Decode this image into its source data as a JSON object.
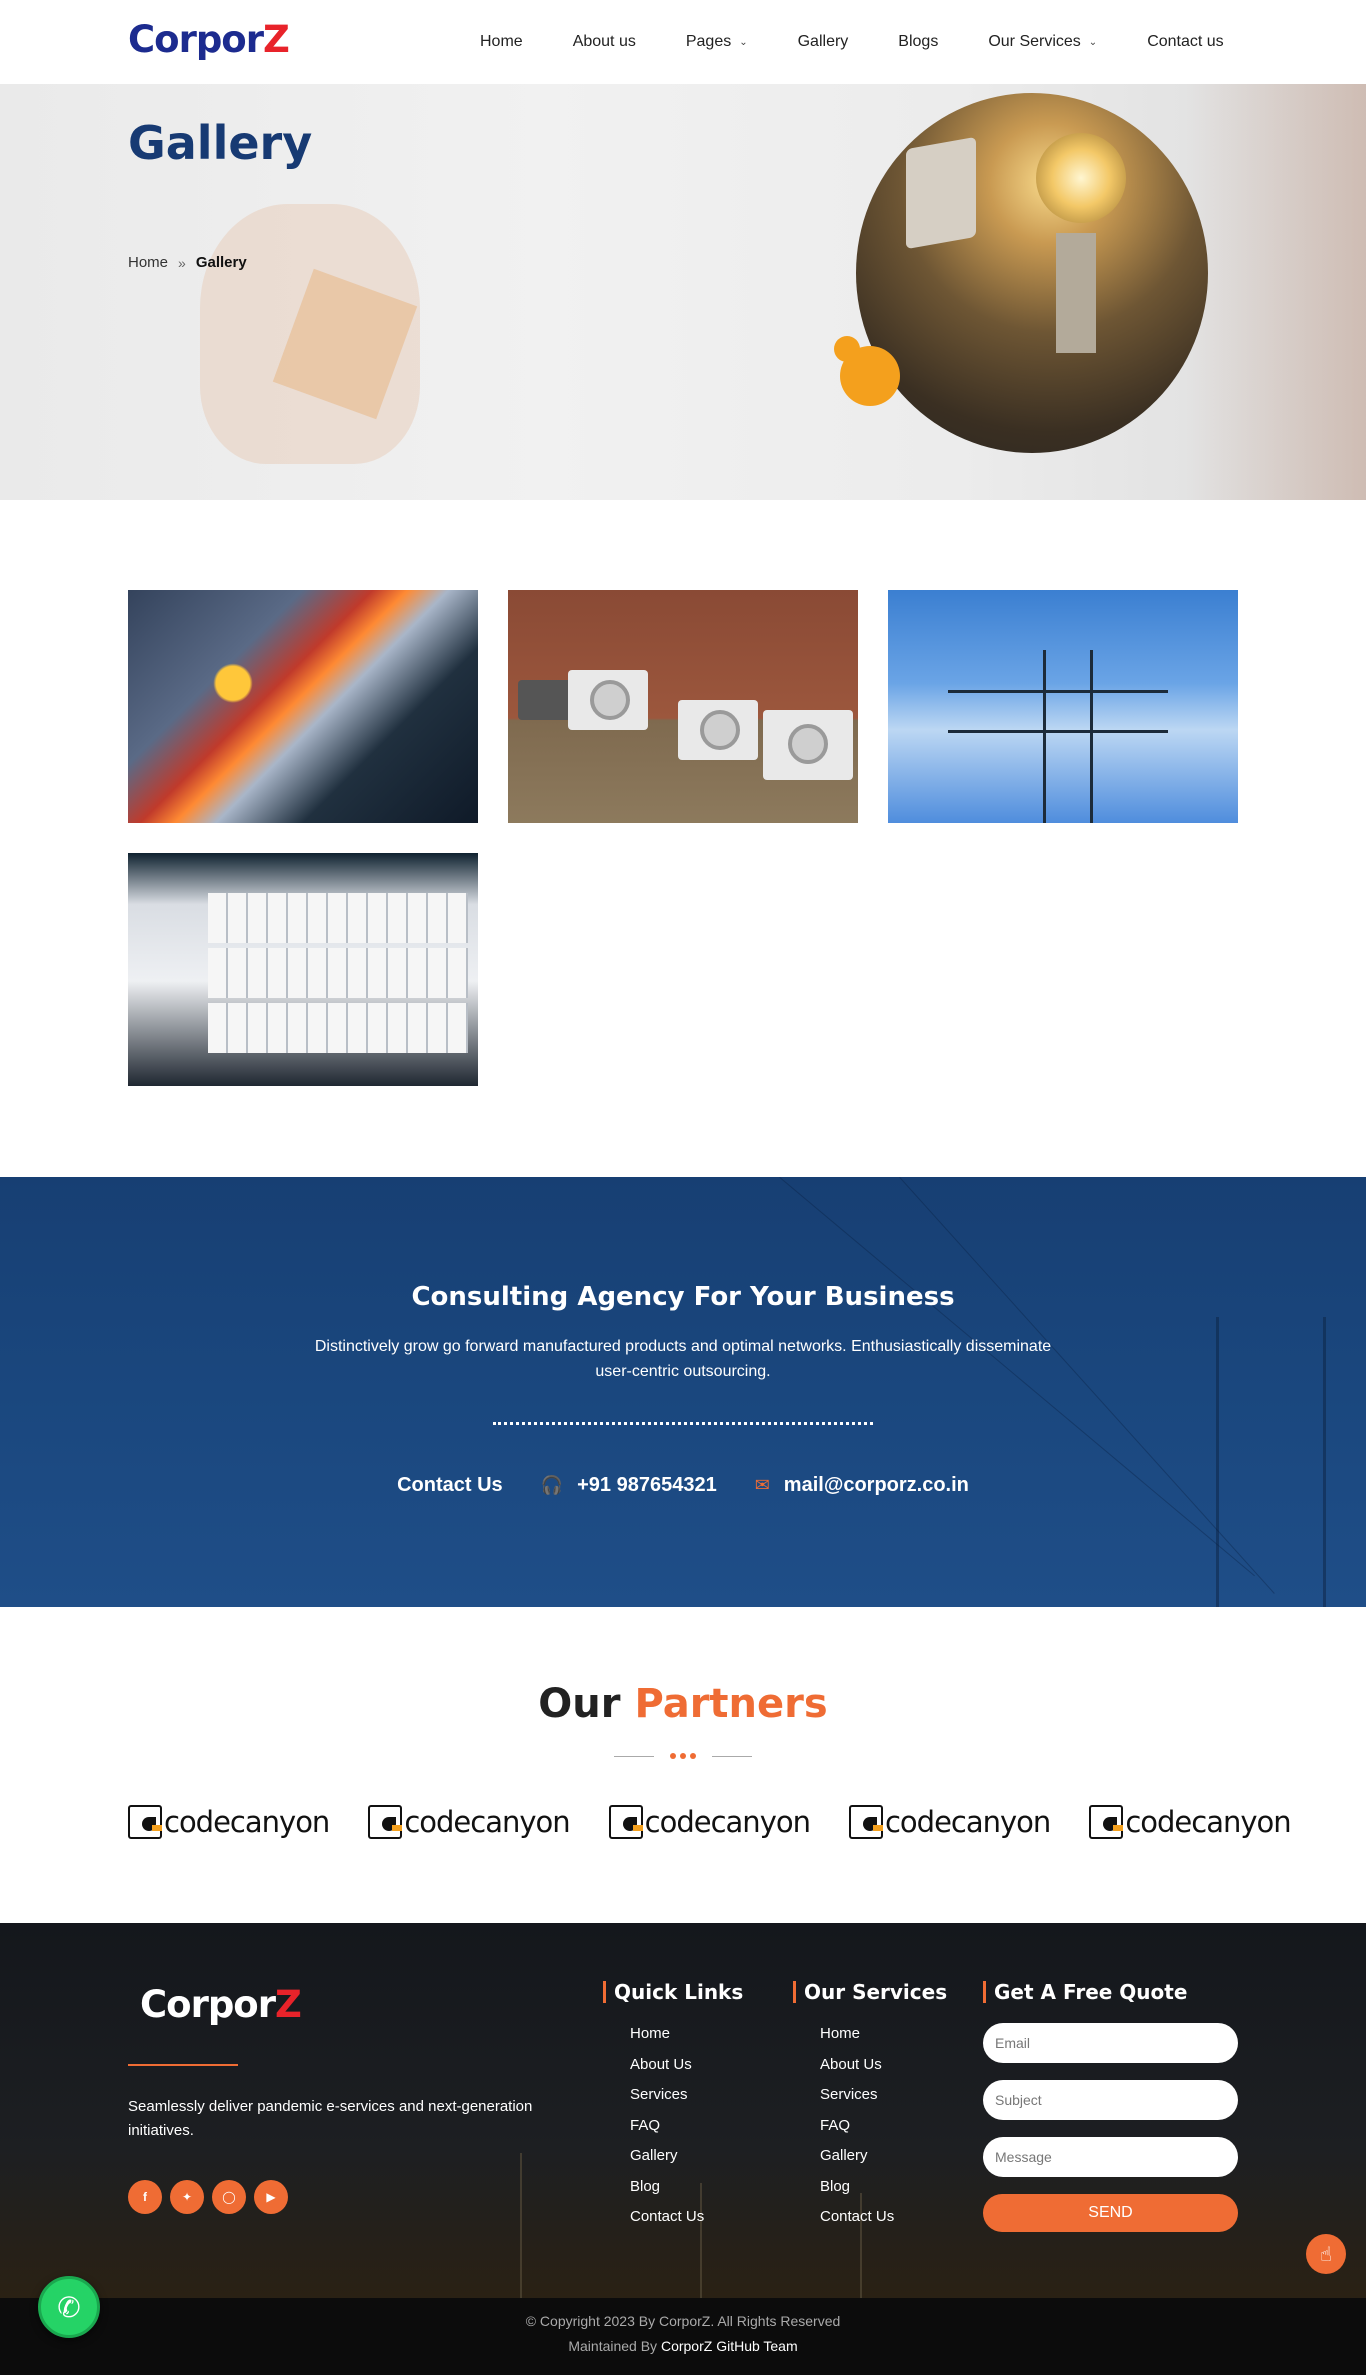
{
  "header": {
    "logo_main": "Corpor",
    "logo_accent": "Z",
    "nav": [
      {
        "label": "Home"
      },
      {
        "label": "About us"
      },
      {
        "label": "Pages"
      },
      {
        "label": "Gallery"
      },
      {
        "label": "Blogs"
      },
      {
        "label": "Our Services"
      },
      {
        "label": "Contact us"
      }
    ]
  },
  "banner": {
    "title": "Gallery",
    "breadcrumb": {
      "home": "Home",
      "separator": "»",
      "current": "Gallery"
    }
  },
  "gallery": {
    "images": [
      "computer-internals",
      "air-conditioner-units",
      "power-transmission-tower",
      "circuit-breaker-panel"
    ]
  },
  "consulting": {
    "title": "Consulting Agency For Your Business",
    "text": "Distinctively grow go forward manufactured products and optimal networks. Enthusiastically disseminate user-centric outsourcing.",
    "contact_label": "Contact Us",
    "phone": "+91 987654321",
    "email": "mail@corporz.co.in"
  },
  "partners": {
    "title_main": "Our",
    "title_accent": "Partners",
    "logos": [
      "codecanyon",
      "codecanyon",
      "codecanyon",
      "codecanyon",
      "codecanyon"
    ]
  },
  "footer": {
    "logo_main": "Corpor",
    "logo_accent": "Z",
    "description": "Seamlessly deliver pandemic e-services and next-generation initiatives.",
    "socials": [
      "facebook-icon",
      "twitter-icon",
      "instagram-icon",
      "youtube-icon"
    ],
    "quick_links": {
      "title": "Quick Links",
      "items": [
        "Home",
        "About Us",
        "Services",
        "FAQ",
        "Gallery",
        "Blog",
        "Contact Us"
      ]
    },
    "our_services": {
      "title": "Our Services",
      "items": [
        "Home",
        "About Us",
        "Services",
        "FAQ",
        "Gallery",
        "Blog",
        "Contact Us"
      ]
    },
    "quote": {
      "title": "Get A Free Quote",
      "email_placeholder": "Email",
      "subject_placeholder": "Subject",
      "message_placeholder": "Message",
      "send_label": "SEND"
    },
    "copyright": "© Copyright 2023 By CorporZ. All Rights Reserved",
    "maintained_prefix": "Maintained By",
    "maintained_team": "CorporZ GitHub Team"
  },
  "colors": {
    "accent": "#ef6c34",
    "brand_blue": "#1c2b8f",
    "title_blue": "#173a73",
    "consult_bg": "#173f73"
  }
}
